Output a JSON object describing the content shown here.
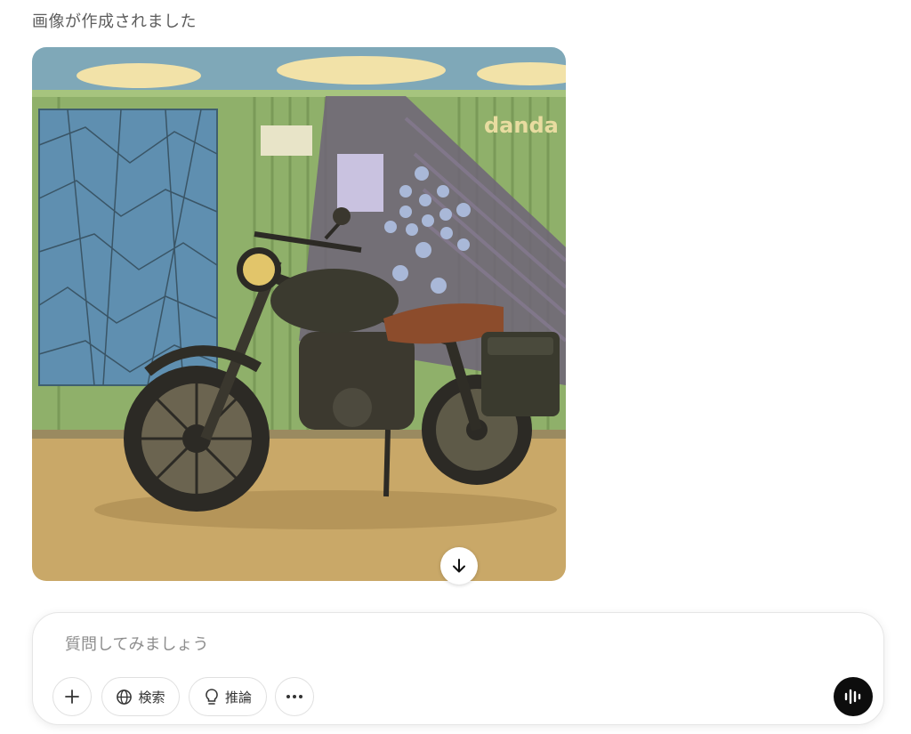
{
  "status": {
    "text": "画像が作成されました"
  },
  "image": {
    "alt": "motorcycle in front of green shipping container",
    "wall_text": "danda"
  },
  "download": {
    "icon": "arrow-down-icon"
  },
  "composer": {
    "placeholder": "質問してみましょう",
    "value": "",
    "buttons": {
      "plus_icon": "plus-icon",
      "search_label": "検索",
      "search_icon": "globe-icon",
      "reason_label": "推論",
      "reason_icon": "lightbulb-icon",
      "more_icon": "more-icon",
      "voice_icon": "voice-mode-icon"
    }
  },
  "colors": {
    "voice_button_bg": "#0d0d0d",
    "placeholder": "#8e8e8e",
    "status_text": "#5d5d5d"
  }
}
